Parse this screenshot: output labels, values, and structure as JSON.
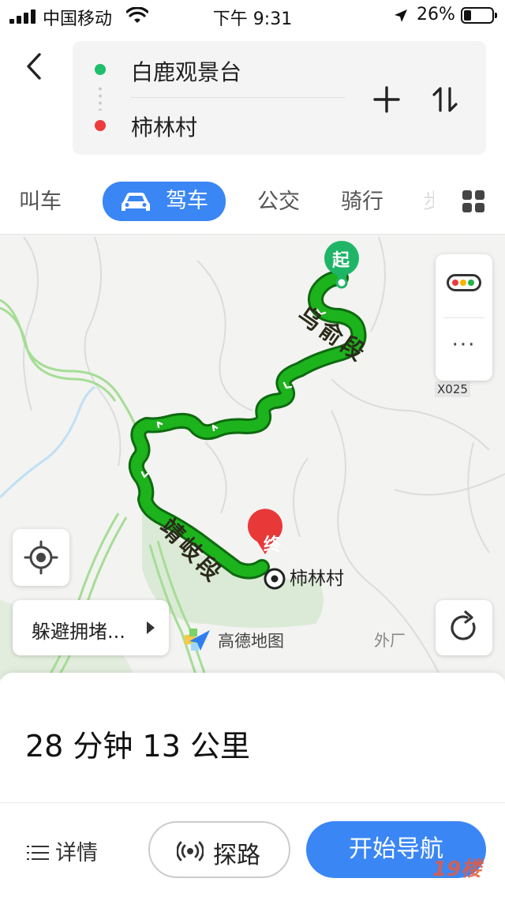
{
  "status_bar": {
    "carrier": "中国移动",
    "time": "下午 9:31",
    "battery": "26%"
  },
  "route": {
    "start": "白鹿观景台",
    "end": "柿林村"
  },
  "tabs": [
    {
      "label": "叫车"
    },
    {
      "label": "驾车"
    },
    {
      "label": "公交"
    },
    {
      "label": "骑行"
    },
    {
      "label": "步"
    }
  ],
  "map": {
    "start_marker": "起",
    "end_marker": "终",
    "road_labels": [
      "乌俞段",
      "靖岐段"
    ],
    "road_code": "X025",
    "destination_label": "柿林村",
    "place_label": "外厂",
    "avoid_label": "躲避拥堵...",
    "brand": "高德地图",
    "route_color": "#1db31d",
    "more": "···"
  },
  "summary": "28 分钟  13 公里",
  "actions": {
    "details": "详情",
    "explore": "探路",
    "start_nav": "开始导航"
  },
  "watermark": "19楼",
  "colors": {
    "accent": "#3a86f5",
    "start_green": "#1fbf6b",
    "end_red": "#ee3b3b"
  }
}
